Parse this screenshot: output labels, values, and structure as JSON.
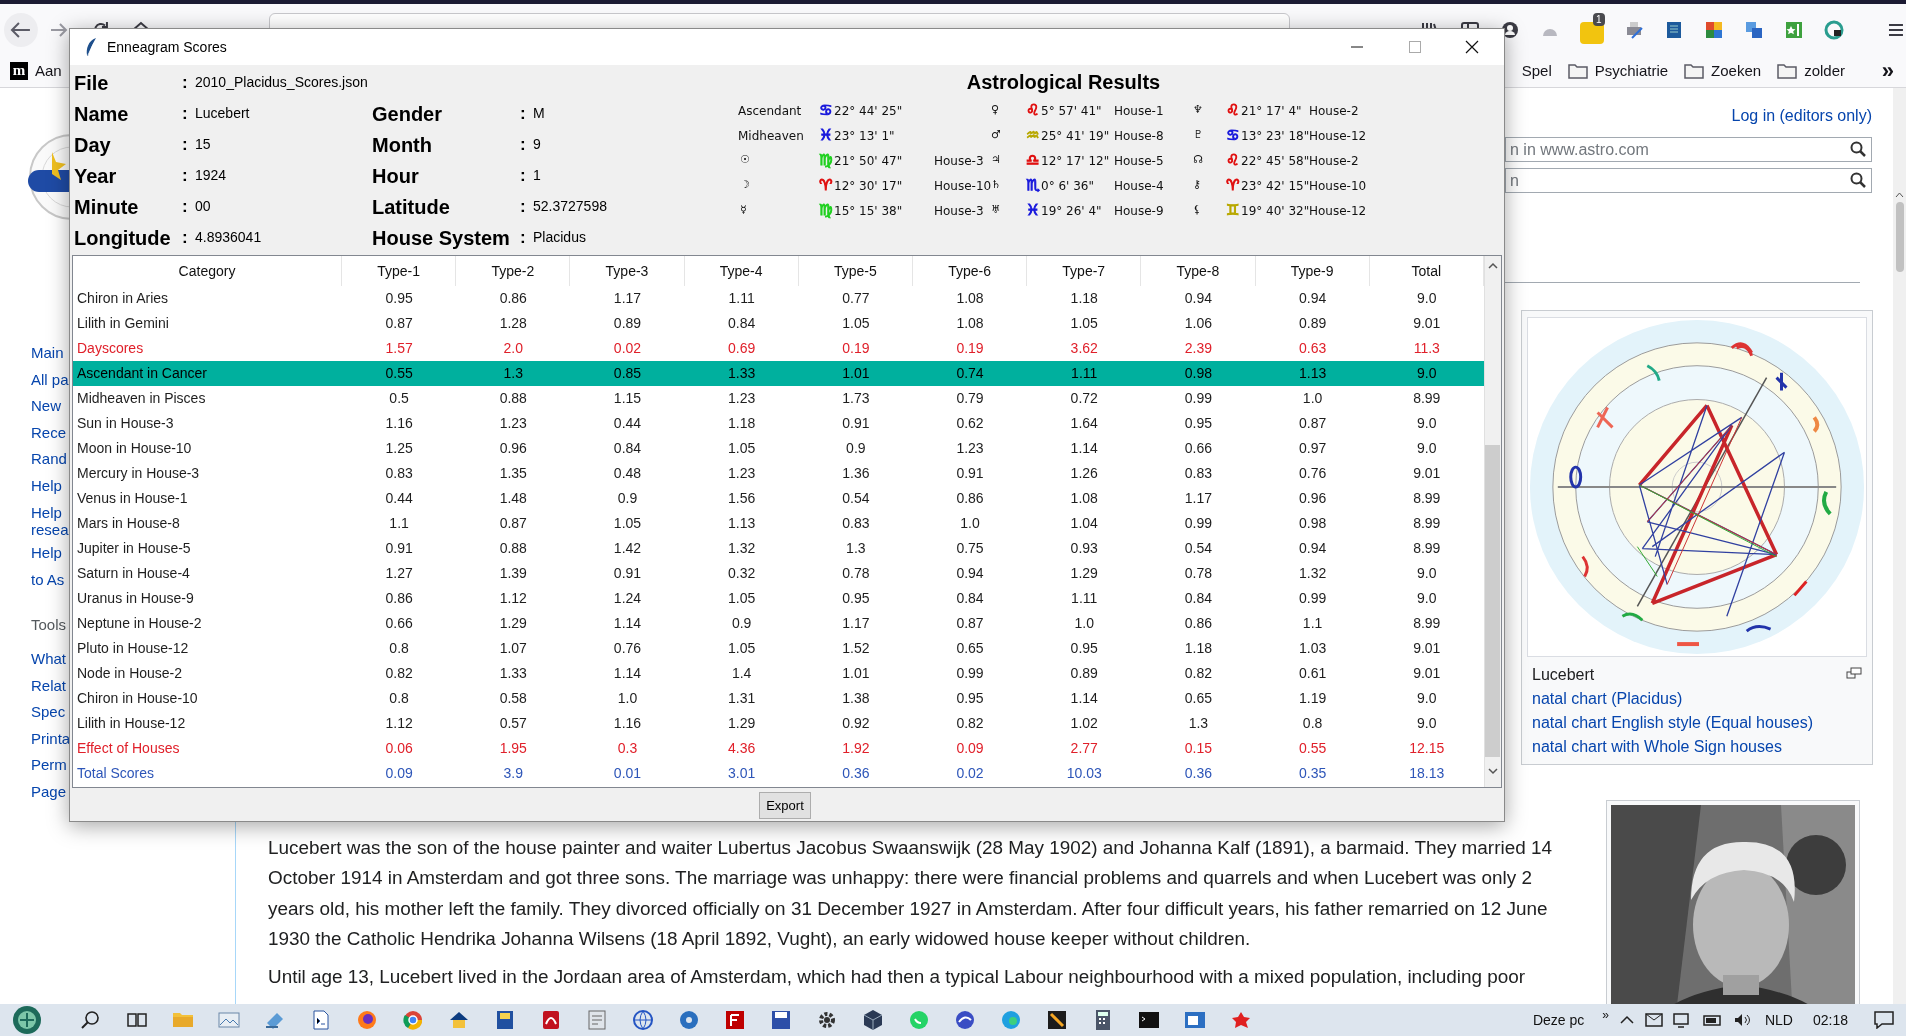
{
  "browser": {
    "bookmarks": [
      {
        "kind": "site",
        "favicon": "m",
        "label": "Aan"
      },
      {
        "kind": "plain",
        "label": "Spel"
      },
      {
        "kind": "folder",
        "label": "Psychiatrie"
      },
      {
        "kind": "folder",
        "label": "Zoeken"
      },
      {
        "kind": "folder",
        "label": "zolder"
      }
    ],
    "bookmarks_overflow": "»",
    "extension_badge": "1"
  },
  "page": {
    "sidebar": [
      {
        "kind": "link",
        "label": "Main"
      },
      {
        "kind": "link",
        "label": "All pa"
      },
      {
        "kind": "link",
        "label": "New"
      },
      {
        "kind": "link",
        "label": "Rece"
      },
      {
        "kind": "link",
        "label": "Rand"
      },
      {
        "kind": "link",
        "label": "Help"
      },
      {
        "kind": "link",
        "label": "Help\nresea"
      },
      {
        "kind": "link",
        "label": "Help"
      },
      {
        "kind": "link",
        "label": "to As"
      },
      {
        "kind": "heading",
        "label": "Tools"
      },
      {
        "kind": "link",
        "label": "What"
      },
      {
        "kind": "link",
        "label": "Relat"
      },
      {
        "kind": "link",
        "label": "Spec"
      },
      {
        "kind": "link",
        "label": "Printa"
      },
      {
        "kind": "link",
        "label": "Perm"
      },
      {
        "kind": "link",
        "label": "Page"
      }
    ],
    "login_link": "Log in (editors only)",
    "search_fields": [
      {
        "placeholder": "n in www.astro.com"
      },
      {
        "placeholder": "n"
      }
    ],
    "infobox": {
      "caption": "Lucebert",
      "links": [
        "natal chart (Placidus)",
        "natal chart English style (Equal houses)",
        "natal chart with Whole Sign houses"
      ]
    },
    "article": [
      {
        "kind": "paragraph",
        "text": "Lucebert was the son of the house painter and waiter Lubertus Jacobus Swaanswijk (28 May 1902) and Johanna Kalf (1891), a barmaid. They married 14 October 1914 in Amsterdam and got three sons. The marriage was unhappy: there were financial problems and quarrels and when Lucebert was only 2 years old, his mother left the family. They divorced officially on 31 December 1927 in Amsterdam. After four difficult years, his father remarried on 12 June 1930 the Catholic Hendrika Johanna Wilsens (18 April 1892, Vught), an early widowed house keeper without children."
      },
      {
        "kind": "cut_line",
        "text": "Until age 13, Lucebert lived in the Jordaan area of Amsterdam, which had then a typical Labour neighbourhood with a mixed population, including poor"
      }
    ]
  },
  "dialog": {
    "title": "Enneagram Scores",
    "info_rows": [
      [
        {
          "label": "File",
          "value": "2010_Placidus_Scores.json"
        }
      ],
      [
        {
          "label": "Name",
          "value": "Lucebert"
        },
        {
          "label": "Gender",
          "value": "M"
        }
      ],
      [
        {
          "label": "Day",
          "value": "15"
        },
        {
          "label": "Month",
          "value": "9"
        }
      ],
      [
        {
          "label": "Year",
          "value": "1924"
        },
        {
          "label": "Hour",
          "value": "1"
        }
      ],
      [
        {
          "label": "Minute",
          "value": "00"
        },
        {
          "label": "Latitude",
          "value": "52.3727598"
        }
      ],
      [
        {
          "label": "Longitude",
          "value": "4.8936041"
        },
        {
          "label": "House System",
          "value": "Placidus"
        }
      ]
    ],
    "separator": ":",
    "astro_title": "Astrological Results",
    "placements": [
      {
        "body": "Ascendant",
        "sign": "♋",
        "color": "#1a1adc",
        "position": "22° 44' 25\""
      },
      {
        "body": "♀",
        "sign": "♌",
        "color": "#e01010",
        "position": "5° 57' 41\"",
        "house": "House-1"
      },
      {
        "body": "♆",
        "sign": "♌",
        "color": "#e01010",
        "position": "21° 17' 4\"",
        "house": "House-2"
      },
      {
        "body": "Midheaven",
        "sign": "♓",
        "color": "#1a1adc",
        "position": "23° 13' 1\""
      },
      {
        "body": "♂",
        "sign": "♒",
        "color": "#b8a800",
        "position": "25° 41' 19\"",
        "house": "House-8"
      },
      {
        "body": "♇",
        "sign": "♋",
        "color": "#1a1adc",
        "position": "13° 23' 18\"",
        "house": "House-12"
      },
      {
        "body": "☉",
        "sign": "♍",
        "color": "#20d020",
        "position": "21° 50' 47\"",
        "house": "House-3"
      },
      {
        "body": "♃",
        "sign": "♎",
        "color": "#e01010",
        "position": "12° 17' 12\"",
        "house": "House-5"
      },
      {
        "body": "☊",
        "sign": "♌",
        "color": "#e01010",
        "position": "22° 45' 58\"",
        "house": "House-2"
      },
      {
        "body": "☽",
        "sign": "♈",
        "color": "#e01010",
        "position": "12° 30' 17\"",
        "house": "House-10"
      },
      {
        "body": "♄",
        "sign": "♏",
        "color": "#1a1adc",
        "position": "0° 6' 36\"",
        "house": "House-4"
      },
      {
        "body": "⚷",
        "sign": "♈",
        "color": "#e01010",
        "position": "23° 42' 15\"",
        "house": "House-10"
      },
      {
        "body": "☿",
        "sign": "♍",
        "color": "#20d020",
        "position": "15° 15' 38\"",
        "house": "House-3"
      },
      {
        "body": "♅",
        "sign": "♓",
        "color": "#1a1adc",
        "position": "19° 26' 4\"",
        "house": "House-9"
      },
      {
        "body": "⚸",
        "sign": "♊",
        "color": "#b8a800",
        "position": "19° 40' 32\"",
        "house": "House-12"
      }
    ],
    "table": {
      "columns": [
        "Category",
        "Type-1",
        "Type-2",
        "Type-3",
        "Type-4",
        "Type-5",
        "Type-6",
        "Type-7",
        "Type-8",
        "Type-9",
        "Total"
      ],
      "rows": [
        {
          "kind": "score",
          "selected": false,
          "cells": [
            "Chiron in Aries",
            "0.95",
            "0.86",
            "1.17",
            "1.11",
            "0.77",
            "1.08",
            "1.18",
            "0.94",
            "0.94",
            "9.0"
          ]
        },
        {
          "kind": "score",
          "selected": false,
          "cells": [
            "Lilith in Gemini",
            "0.87",
            "1.28",
            "0.89",
            "0.84",
            "1.05",
            "1.08",
            "1.05",
            "1.06",
            "0.89",
            "9.01"
          ]
        },
        {
          "kind": "subtotal",
          "selected": false,
          "cells": [
            "Dayscores",
            "1.57",
            "2.0",
            "0.02",
            "0.69",
            "0.19",
            "0.19",
            "3.62",
            "2.39",
            "0.63",
            "11.3"
          ]
        },
        {
          "kind": "score",
          "selected": true,
          "cells": [
            "Ascendant in Cancer",
            "0.55",
            "1.3",
            "0.85",
            "1.33",
            "1.01",
            "0.74",
            "1.11",
            "0.98",
            "1.13",
            "9.0"
          ]
        },
        {
          "kind": "score",
          "selected": false,
          "cells": [
            "Midheaven in Pisces",
            "0.5",
            "0.88",
            "1.15",
            "1.23",
            "1.73",
            "0.79",
            "0.72",
            "0.99",
            "1.0",
            "8.99"
          ]
        },
        {
          "kind": "score",
          "selected": false,
          "cells": [
            "Sun in House-3",
            "1.16",
            "1.23",
            "0.44",
            "1.18",
            "0.91",
            "0.62",
            "1.64",
            "0.95",
            "0.87",
            "9.0"
          ]
        },
        {
          "kind": "score",
          "selected": false,
          "cells": [
            "Moon in House-10",
            "1.25",
            "0.96",
            "0.84",
            "1.05",
            "0.9",
            "1.23",
            "1.14",
            "0.66",
            "0.97",
            "9.0"
          ]
        },
        {
          "kind": "score",
          "selected": false,
          "cells": [
            "Mercury in House-3",
            "0.83",
            "1.35",
            "0.48",
            "1.23",
            "1.36",
            "0.91",
            "1.26",
            "0.83",
            "0.76",
            "9.01"
          ]
        },
        {
          "kind": "score",
          "selected": false,
          "cells": [
            "Venus in House-1",
            "0.44",
            "1.48",
            "0.9",
            "1.56",
            "0.54",
            "0.86",
            "1.08",
            "1.17",
            "0.96",
            "8.99"
          ]
        },
        {
          "kind": "score",
          "selected": false,
          "cells": [
            "Mars in House-8",
            "1.1",
            "0.87",
            "1.05",
            "1.13",
            "0.83",
            "1.0",
            "1.04",
            "0.99",
            "0.98",
            "8.99"
          ]
        },
        {
          "kind": "score",
          "selected": false,
          "cells": [
            "Jupiter in House-5",
            "0.91",
            "0.88",
            "1.42",
            "1.32",
            "1.3",
            "0.75",
            "0.93",
            "0.54",
            "0.94",
            "8.99"
          ]
        },
        {
          "kind": "score",
          "selected": false,
          "cells": [
            "Saturn in House-4",
            "1.27",
            "1.39",
            "0.91",
            "0.32",
            "0.78",
            "0.94",
            "1.29",
            "0.78",
            "1.32",
            "9.0"
          ]
        },
        {
          "kind": "score",
          "selected": false,
          "cells": [
            "Uranus in House-9",
            "0.86",
            "1.12",
            "1.24",
            "1.05",
            "0.95",
            "0.84",
            "1.11",
            "0.84",
            "0.99",
            "9.0"
          ]
        },
        {
          "kind": "score",
          "selected": false,
          "cells": [
            "Neptune in House-2",
            "0.66",
            "1.29",
            "1.14",
            "0.9",
            "1.17",
            "0.87",
            "1.0",
            "0.86",
            "1.1",
            "8.99"
          ]
        },
        {
          "kind": "score",
          "selected": false,
          "cells": [
            "Pluto in House-12",
            "0.8",
            "1.07",
            "0.76",
            "1.05",
            "1.52",
            "0.65",
            "0.95",
            "1.18",
            "1.03",
            "9.01"
          ]
        },
        {
          "kind": "score",
          "selected": false,
          "cells": [
            "Node in House-2",
            "0.82",
            "1.33",
            "1.14",
            "1.4",
            "1.01",
            "0.99",
            "0.89",
            "0.82",
            "0.61",
            "9.01"
          ]
        },
        {
          "kind": "score",
          "selected": false,
          "cells": [
            "Chiron in House-10",
            "0.8",
            "0.58",
            "1.0",
            "1.31",
            "1.38",
            "0.95",
            "1.14",
            "0.65",
            "1.19",
            "9.0"
          ]
        },
        {
          "kind": "score",
          "selected": false,
          "cells": [
            "Lilith in House-12",
            "1.12",
            "0.57",
            "1.16",
            "1.29",
            "0.92",
            "0.82",
            "1.02",
            "1.3",
            "0.8",
            "9.0"
          ]
        },
        {
          "kind": "subtotal",
          "selected": false,
          "cells": [
            "Effect of Houses",
            "0.06",
            "1.95",
            "0.3",
            "4.36",
            "1.92",
            "0.09",
            "2.77",
            "0.15",
            "0.55",
            "12.15"
          ]
        },
        {
          "kind": "total",
          "selected": false,
          "cells": [
            "Total Scores",
            "0.09",
            "3.9",
            "0.01",
            "3.01",
            "0.36",
            "0.02",
            "10.03",
            "0.36",
            "0.35",
            "18.13"
          ]
        }
      ]
    },
    "export_button": "Export"
  },
  "taskbar": {
    "computer_label": "Deze pc",
    "chevron": "»",
    "language": "NLD",
    "time": "02:18"
  }
}
